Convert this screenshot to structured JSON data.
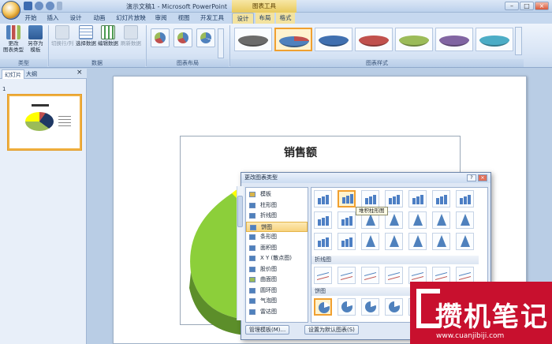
{
  "window": {
    "title": "演示文稿1 - Microsoft PowerPoint",
    "context_title": "图表工具",
    "controls": [
      "–",
      "□",
      "×"
    ]
  },
  "tabs": [
    {
      "label": "开始"
    },
    {
      "label": "插入"
    },
    {
      "label": "设计"
    },
    {
      "label": "动画"
    },
    {
      "label": "幻灯片放映"
    },
    {
      "label": "审阅"
    },
    {
      "label": "视图"
    },
    {
      "label": "开发工具"
    },
    {
      "label": "设计"
    },
    {
      "label": "布局"
    },
    {
      "label": "格式"
    }
  ],
  "ribbon": {
    "type_group": {
      "label": "类型",
      "change_type": "更改\n图表类型",
      "save_template": "另存为\n模板"
    },
    "data_group": {
      "label": "数据",
      "switch_row_col": "切换行/列",
      "select_data": "选择数据",
      "edit_data": "编辑数据",
      "refresh_data": "刷新数据"
    },
    "layout_group": {
      "label": "图表布局"
    },
    "style_group": {
      "label": "图表样式"
    },
    "style_colors": [
      "#6b6b6b",
      "#4f81bd",
      "#3f6fb0",
      "#c0504d",
      "#9bbb59",
      "#8064a2",
      "#4bacc6"
    ]
  },
  "left_panel": {
    "tabs": [
      "幻灯片",
      "大纲"
    ],
    "close": "×",
    "slide_number": "1"
  },
  "slide": {
    "chart_title": "销售额"
  },
  "dialog": {
    "title": "更改图表类型",
    "help": "?",
    "close": "×",
    "categories": [
      {
        "label": "模板"
      },
      {
        "label": "柱形图"
      },
      {
        "label": "折线图"
      },
      {
        "label": "饼图"
      },
      {
        "label": "条形图"
      },
      {
        "label": "面积图"
      },
      {
        "label": "X Y (散点图)"
      },
      {
        "label": "股价图"
      },
      {
        "label": "曲面图"
      },
      {
        "label": "圆环图"
      },
      {
        "label": "气泡图"
      },
      {
        "label": "雷达图"
      }
    ],
    "selected_category": "饼图",
    "sections": {
      "line": "折线图",
      "pie": "饼图"
    },
    "tooltip": "堆积柱形图",
    "buttons": {
      "manage_templates": "管理模板(M)...",
      "set_default": "设置为默认图表(S)"
    }
  },
  "watermark": {
    "text": "攒机笔记",
    "url": "www.cuanjibiji.com"
  }
}
